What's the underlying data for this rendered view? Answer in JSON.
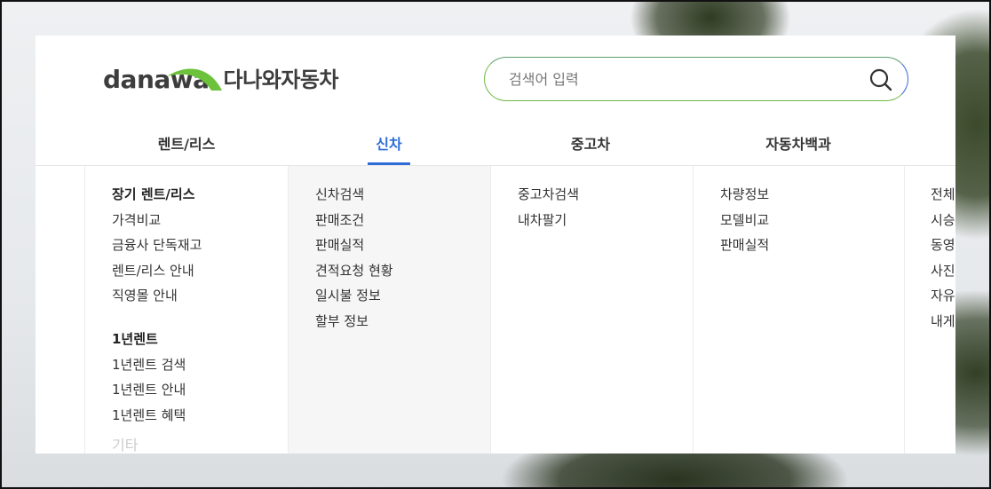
{
  "brand": {
    "logo_text": "danawa",
    "name": "다나와자동차",
    "green": "#6cc23a"
  },
  "search": {
    "placeholder": "검색어 입력",
    "value": "",
    "icon": "search-icon"
  },
  "gnb": {
    "active_color": "#2f6cd8",
    "items": [
      {
        "label": "렌트/리스"
      },
      {
        "label": "신차",
        "active": true
      },
      {
        "label": "중고차"
      },
      {
        "label": "자동차백과"
      }
    ]
  },
  "menu": {
    "rent": {
      "group1_title": "장기 렌트/리스",
      "group1_items": [
        "가격비교",
        "금융사 단독재고",
        "렌트/리스 안내",
        "직영몰 안내"
      ],
      "group2_title": "1년렌트",
      "group2_items": [
        "1년렌트 검색",
        "1년렌트 안내",
        "1년렌트 혜택"
      ],
      "faded_item": "기타"
    },
    "newcar": [
      "신차검색",
      "판매조건",
      "판매실적",
      "견적요청 현황",
      "일시불 정보",
      "할부 정보"
    ],
    "usedcar": [
      "중고차검색",
      "내차팔기"
    ],
    "encyclopedia": [
      "차량정보",
      "모델비교",
      "판매실적"
    ],
    "community": [
      "전체",
      "시승",
      "동영",
      "사진",
      "자유",
      "내게"
    ]
  }
}
